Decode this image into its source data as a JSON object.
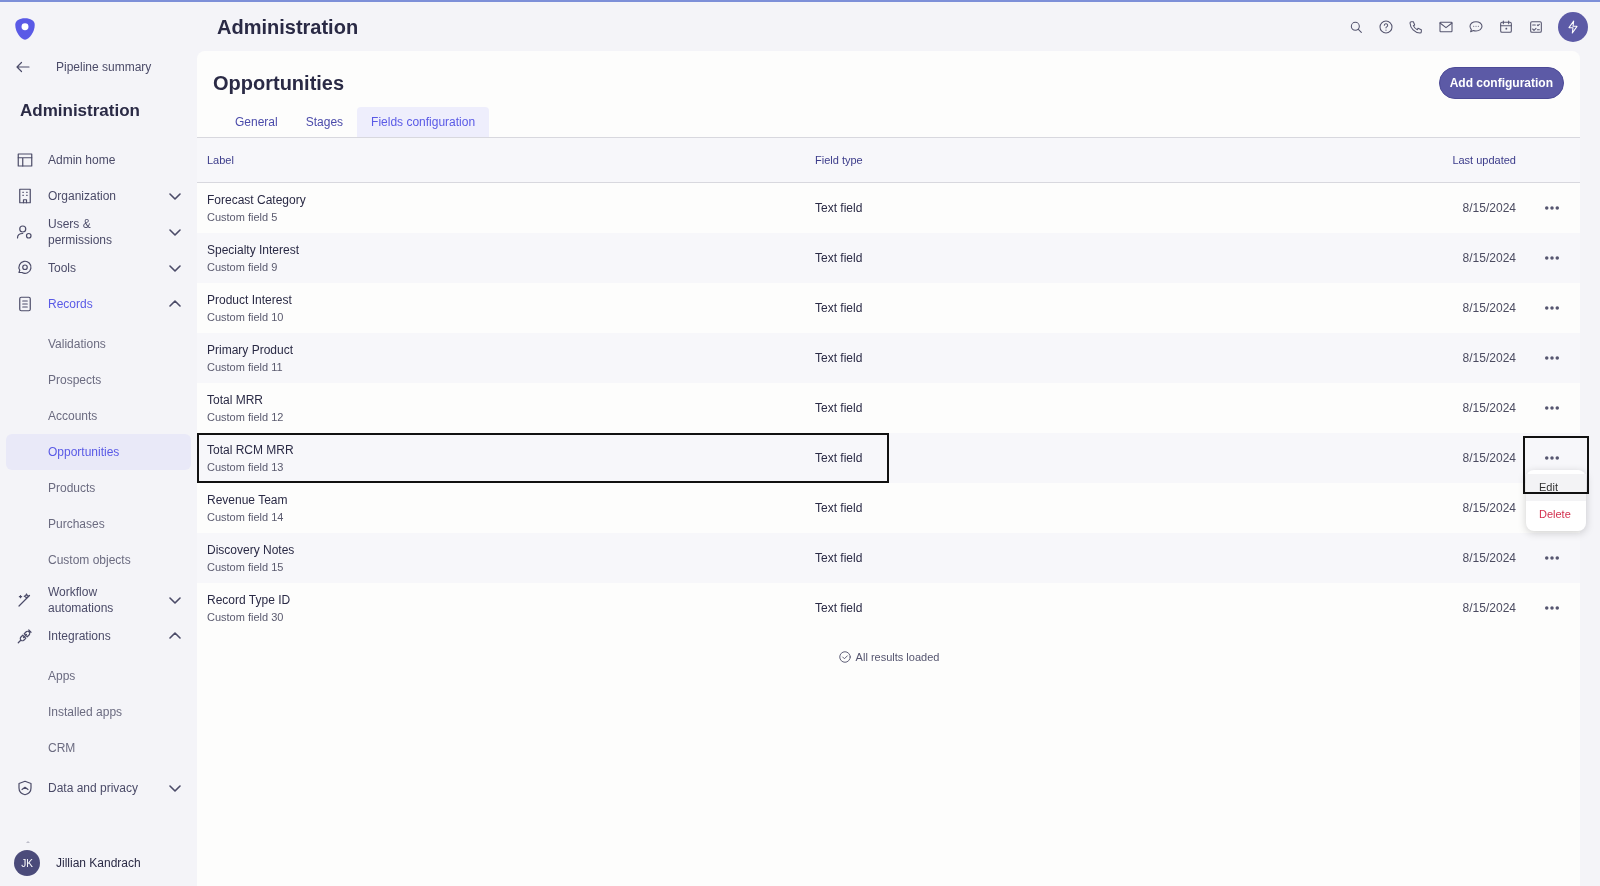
{
  "back_link": "Pipeline summary",
  "sidebar": {
    "title": "Administration",
    "items": [
      {
        "label": "Admin home",
        "selected": false
      },
      {
        "label": "Organization",
        "expanded": false,
        "selected": false
      },
      {
        "label": "Users & permissions",
        "expanded": false,
        "selected": false
      },
      {
        "label": "Tools",
        "expanded": false,
        "selected": false
      },
      {
        "label": "Records",
        "expanded": true,
        "selected": false,
        "children": [
          {
            "label": "Validations",
            "selected": false
          },
          {
            "label": "Prospects",
            "selected": false
          },
          {
            "label": "Accounts",
            "selected": false
          },
          {
            "label": "Opportunities",
            "selected": true
          },
          {
            "label": "Products",
            "selected": false
          },
          {
            "label": "Purchases",
            "selected": false
          },
          {
            "label": "Custom objects",
            "selected": false
          }
        ]
      },
      {
        "label": "Workflow automations",
        "expanded": false,
        "selected": false
      },
      {
        "label": "Integrations",
        "expanded": true,
        "selected": false,
        "children": [
          {
            "label": "Apps",
            "selected": false
          },
          {
            "label": "Installed apps",
            "selected": false
          },
          {
            "label": "CRM",
            "selected": false
          }
        ]
      },
      {
        "label": "Data and privacy",
        "expanded": false,
        "selected": false
      }
    ]
  },
  "user": {
    "initials": "JK",
    "name": "Jillian Kandrach"
  },
  "header": {
    "title": "Administration"
  },
  "page": {
    "title": "Opportunities",
    "add_button": "Add configuration",
    "tabs": [
      {
        "label": "General",
        "selected": false
      },
      {
        "label": "Stages",
        "selected": false
      },
      {
        "label": "Fields configuration",
        "selected": true
      }
    ]
  },
  "table": {
    "columns": [
      "Label",
      "Field type",
      "Last updated"
    ],
    "rows": [
      {
        "label": "Forecast Category",
        "sub": "Custom field 5",
        "type": "Text field",
        "updated": "8/15/2024",
        "outlined": false
      },
      {
        "label": "Specialty Interest",
        "sub": "Custom field 9",
        "type": "Text field",
        "updated": "8/15/2024",
        "outlined": false
      },
      {
        "label": "Product Interest",
        "sub": "Custom field 10",
        "type": "Text field",
        "updated": "8/15/2024",
        "outlined": false
      },
      {
        "label": "Primary Product",
        "sub": "Custom field 11",
        "type": "Text field",
        "updated": "8/15/2024",
        "outlined": false
      },
      {
        "label": "Total MRR",
        "sub": "Custom field 12",
        "type": "Text field",
        "updated": "8/15/2024",
        "outlined": false
      },
      {
        "label": "Total RCM MRR",
        "sub": "Custom field 13",
        "type": "Text field",
        "updated": "8/15/2024",
        "outlined": true,
        "menu": {
          "outlined": true,
          "items": [
            {
              "label": "Edit",
              "kind": "normal"
            },
            {
              "label": "Delete",
              "kind": "danger"
            }
          ]
        }
      },
      {
        "label": "Revenue Team",
        "sub": "Custom field 14",
        "type": "Text field",
        "updated": "8/15/2024",
        "outlined": false
      },
      {
        "label": "Discovery Notes",
        "sub": "Custom field 15",
        "type": "Text field",
        "updated": "8/15/2024",
        "outlined": false
      },
      {
        "label": "Record Type ID",
        "sub": "Custom field 30",
        "type": "Text field",
        "updated": "8/15/2024",
        "outlined": false
      }
    ],
    "footer": "All results loaded"
  }
}
